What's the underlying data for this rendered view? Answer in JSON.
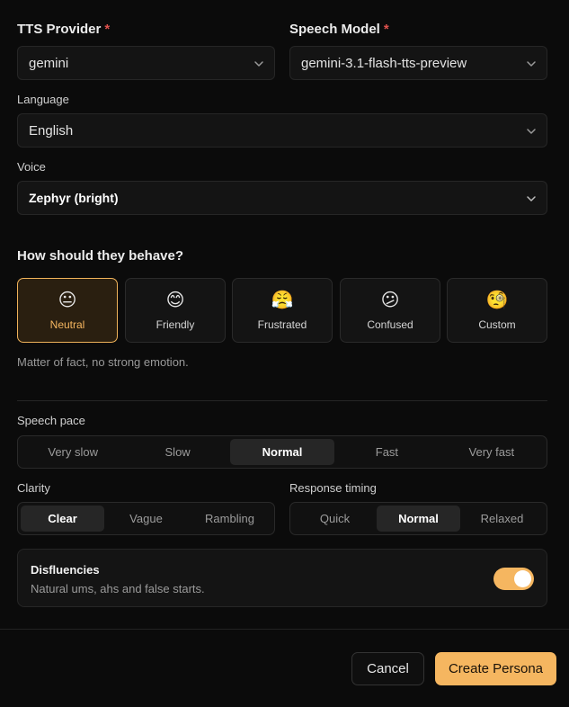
{
  "tts_provider": {
    "label": "TTS Provider",
    "required_mark": "*",
    "value": "gemini"
  },
  "speech_model": {
    "label": "Speech Model",
    "required_mark": "*",
    "value": "gemini-3.1-flash-tts-preview"
  },
  "language": {
    "label": "Language",
    "value": "English"
  },
  "voice": {
    "label": "Voice",
    "value": "Zephyr (bright)"
  },
  "behavior": {
    "title": "How should they behave?",
    "moods": [
      {
        "emoji": "😐",
        "label": "Neutral",
        "active": true
      },
      {
        "emoji": "😊",
        "label": "Friendly",
        "active": false
      },
      {
        "emoji": "😤",
        "label": "Frustrated",
        "active": false
      },
      {
        "emoji": "😕",
        "label": "Confused",
        "active": false
      },
      {
        "emoji": "🧐",
        "label": "Custom",
        "active": false
      }
    ],
    "description": "Matter of fact, no strong emotion."
  },
  "speech_pace": {
    "label": "Speech pace",
    "options": [
      "Very slow",
      "Slow",
      "Normal",
      "Fast",
      "Very fast"
    ],
    "selected": "Normal"
  },
  "clarity": {
    "label": "Clarity",
    "options": [
      "Clear",
      "Vague",
      "Rambling"
    ],
    "selected": "Clear"
  },
  "response_timing": {
    "label": "Response timing",
    "options": [
      "Quick",
      "Normal",
      "Relaxed"
    ],
    "selected": "Normal"
  },
  "disfluencies": {
    "title": "Disfluencies",
    "subtitle": "Natural ums, ahs and false starts.",
    "enabled": true
  },
  "footer": {
    "cancel_label": "Cancel",
    "create_label": "Create Persona"
  },
  "colors": {
    "accent": "#f5b660",
    "required": "#e0524e",
    "background": "#0b0b0b"
  }
}
